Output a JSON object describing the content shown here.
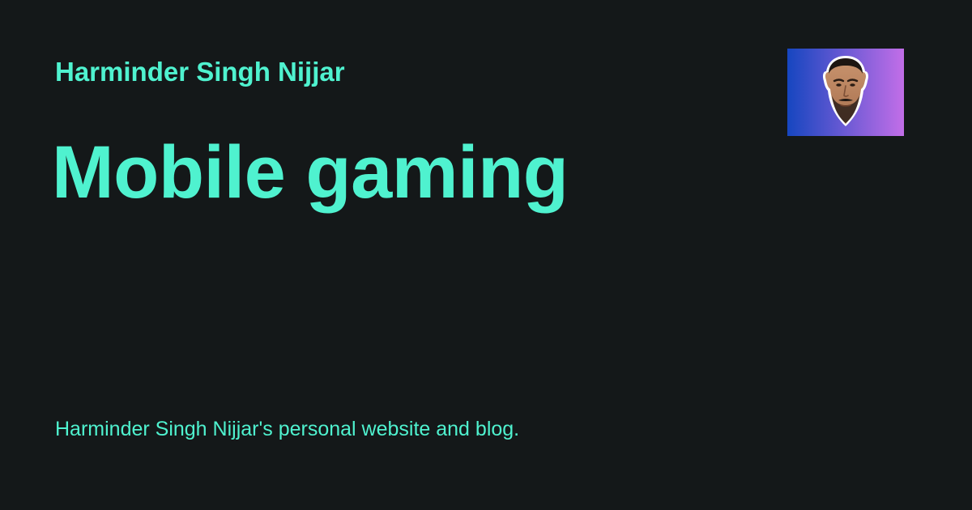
{
  "header": {
    "site_name": "Harminder Singh Nijjar"
  },
  "post": {
    "title": "Mobile gaming"
  },
  "footer": {
    "description": "Harminder Singh Nijjar's personal website and blog."
  },
  "avatar": {
    "icon": "face-portrait-icon",
    "gradient_start": "#1646c0",
    "gradient_end": "#c26ee8"
  },
  "colors": {
    "background": "#141819",
    "accent": "#4ff2cf"
  }
}
